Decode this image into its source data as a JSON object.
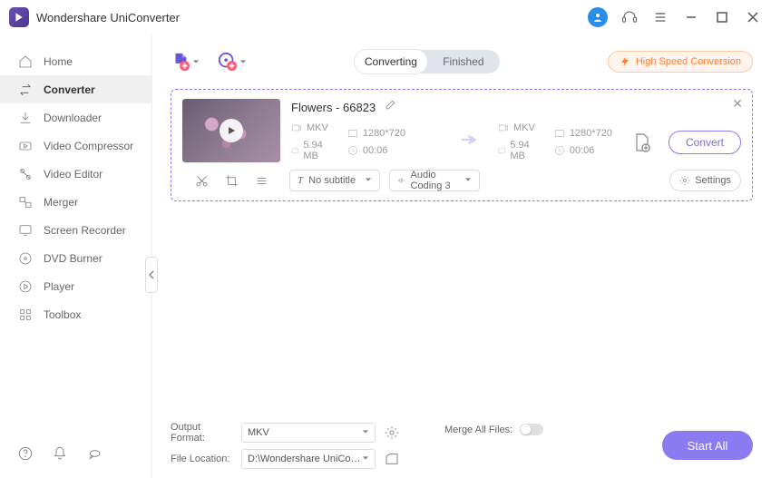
{
  "app": {
    "title": "Wondershare UniConverter"
  },
  "sidebar": {
    "items": [
      {
        "label": "Home"
      },
      {
        "label": "Converter"
      },
      {
        "label": "Downloader"
      },
      {
        "label": "Video Compressor"
      },
      {
        "label": "Video Editor"
      },
      {
        "label": "Merger"
      },
      {
        "label": "Screen Recorder"
      },
      {
        "label": "DVD Burner"
      },
      {
        "label": "Player"
      },
      {
        "label": "Toolbox"
      }
    ]
  },
  "tabs": {
    "converting": "Converting",
    "finished": "Finished"
  },
  "hsc": "High Speed Conversion",
  "file": {
    "name": "Flowers - 66823",
    "src": {
      "format": "MKV",
      "resolution": "1280*720",
      "size": "5.94 MB",
      "duration": "00:06"
    },
    "dst": {
      "format": "MKV",
      "resolution": "1280*720",
      "size": "5.94 MB",
      "duration": "00:06"
    },
    "subtitle": "No subtitle",
    "audio": "Audio Coding 3",
    "settings": "Settings",
    "convert": "Convert"
  },
  "bottom": {
    "fmt_label": "Output Format:",
    "fmt_value": "MKV",
    "loc_label": "File Location:",
    "loc_value": "D:\\Wondershare UniConverter",
    "merge_label": "Merge All Files:",
    "start": "Start All"
  }
}
